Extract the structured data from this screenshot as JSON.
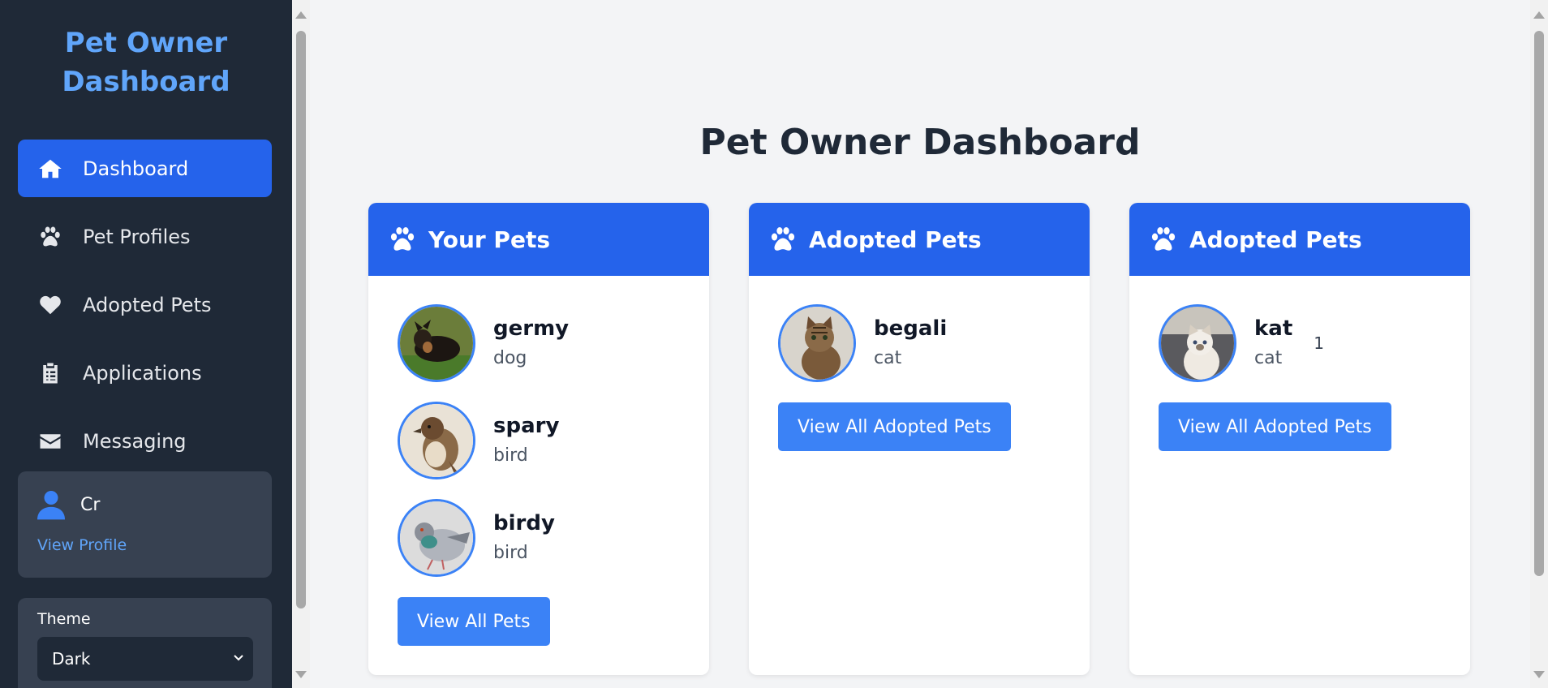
{
  "sidebar": {
    "title": "Pet Owner Dashboard",
    "items": [
      {
        "label": "Dashboard",
        "icon": "home-icon",
        "active": true
      },
      {
        "label": "Pet Profiles",
        "icon": "paw-icon"
      },
      {
        "label": "Adopted Pets",
        "icon": "heart-icon"
      },
      {
        "label": "Applications",
        "icon": "clipboard-icon"
      },
      {
        "label": "Messaging",
        "icon": "envelope-icon"
      }
    ],
    "profile": {
      "name": "Cr",
      "link": "View Profile"
    },
    "theme": {
      "label": "Theme",
      "value": "Dark"
    }
  },
  "main": {
    "title": "Pet Owner Dashboard",
    "cards": [
      {
        "title": "Your Pets",
        "pets": [
          {
            "name": "germy",
            "type": "dog"
          },
          {
            "name": "spary",
            "type": "bird"
          },
          {
            "name": "birdy",
            "type": "bird"
          }
        ],
        "button": "View All Pets"
      },
      {
        "title": "Adopted Pets",
        "pets": [
          {
            "name": "begali",
            "type": "cat"
          }
        ],
        "button": "View All Adopted Pets"
      },
      {
        "title": "Adopted Pets",
        "pets": [
          {
            "name": "kat",
            "type": "cat",
            "badge": "1"
          }
        ],
        "button": "View All Adopted Pets"
      }
    ]
  },
  "colors": {
    "sidebar": "#1f2937",
    "accent": "#2563eb",
    "button": "#3b82f6",
    "link": "#60a5fa"
  }
}
